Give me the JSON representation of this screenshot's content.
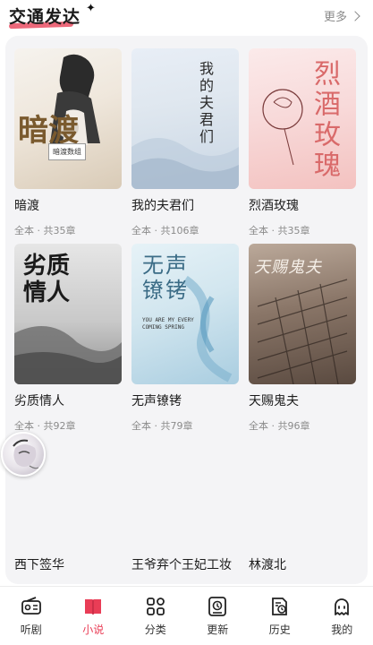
{
  "section": {
    "title": "交通发达",
    "more_label": "更多"
  },
  "books": [
    {
      "title": "暗渡",
      "meta": "全本 · 共35章",
      "cover_text": "暗渡",
      "cover_sub": "暗渡数组"
    },
    {
      "title": "我的夫君们",
      "meta": "全本 · 共106章",
      "cover_text": "我的夫君们"
    },
    {
      "title": "烈酒玫瑰",
      "meta": "全本 · 共35章",
      "cover_text": "烈酒玫瑰"
    },
    {
      "title": "劣质情人",
      "meta": "全本 · 共92章",
      "cover_text": "劣质情人"
    },
    {
      "title": "无声镣铐",
      "meta": "全本 · 共79章",
      "cover_text": "无声镣铐",
      "cover_sub": "YOU ARE MY EVERY COMING SPRING"
    },
    {
      "title": "天赐鬼夫",
      "meta": "全本 · 共96章",
      "cover_text": "天赐鬼夫"
    }
  ],
  "partial_titles": [
    "西下签华",
    "王爷弃个王妃工妆",
    "林渡北"
  ],
  "tabbar": {
    "items": [
      {
        "label": "听剧",
        "icon": "radio-icon"
      },
      {
        "label": "小说",
        "icon": "book-icon"
      },
      {
        "label": "分类",
        "icon": "grid-icon"
      },
      {
        "label": "更新",
        "icon": "update-icon"
      },
      {
        "label": "历史",
        "icon": "history-icon"
      },
      {
        "label": "我的",
        "icon": "ghost-icon"
      }
    ],
    "active_index": 1
  },
  "colors": {
    "accent": "#e93d56",
    "panel_bg": "#f4f4f6",
    "meta_text": "#8b8b8b"
  }
}
